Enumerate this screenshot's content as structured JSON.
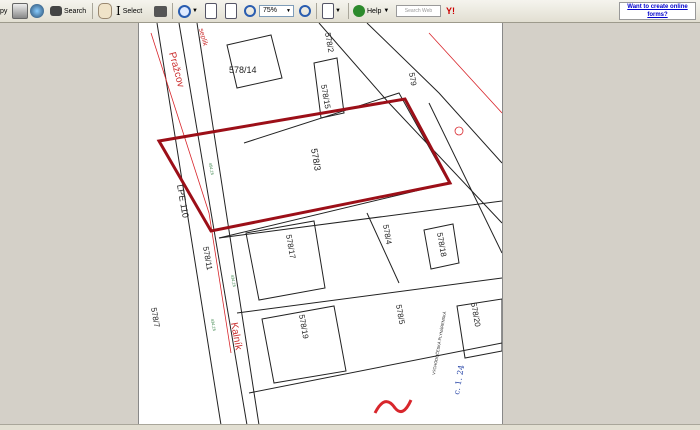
{
  "toolbar": {
    "copy_label": "py",
    "search_label": "Search",
    "select_label": "Select",
    "zoom_value": "75%",
    "help_label": "Help",
    "search_web_placeholder": "Search Web",
    "yahoo_logo": "Y!",
    "promo_link": "Want to create online forms?"
  },
  "drawing": {
    "parcels": [
      "578/14",
      "578/2",
      "578/15",
      "579",
      "578/3",
      "578/4",
      "578/18",
      "578/17",
      "578/11",
      "578/5",
      "578/19",
      "578/20",
      "578/7"
    ],
    "street_labels": [
      "seplik",
      "Pražcov",
      "LPE 110",
      "Kalník"
    ],
    "small_notes": [
      "454,15",
      "434,15",
      "434,15"
    ],
    "stamp_text": "VÝCHODOČESKÁ PLYNÁRENSKÁ",
    "handwritten_date": "c. 1. 24"
  },
  "colors": {
    "boundary_red": "#9c0f18",
    "pencil": "#222",
    "utility_red": "#d8262c"
  }
}
